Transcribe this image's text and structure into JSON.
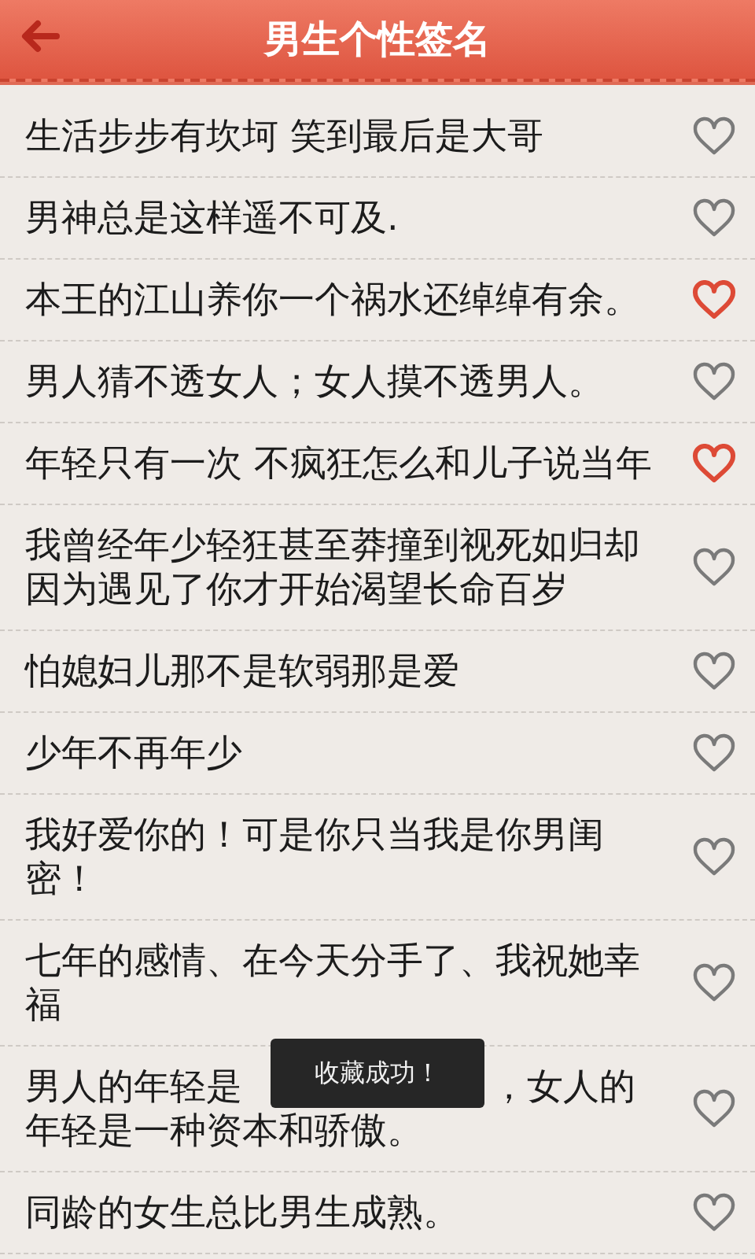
{
  "header": {
    "title": "男生个性签名"
  },
  "items": [
    {
      "text_parts": [
        "生活步步有坎坷 笑到最后是大哥"
      ],
      "favorited": false
    },
    {
      "text_parts": [
        "男神总是这样遥不可及."
      ],
      "favorited": false
    },
    {
      "text_parts": [
        "本王的江山养你一个祸水还绰绰有余。"
      ],
      "favorited": true
    },
    {
      "text_parts": [
        "男人猜不透女人；女人摸不透男人。"
      ],
      "favorited": false
    },
    {
      "text_parts": [
        "年轻只有一次 不疯狂怎么和儿子说当年"
      ],
      "favorited": true
    },
    {
      "text_parts": [
        "我曾经年少轻狂甚至莽撞到视死如归却因为遇见了你才开始渴望长命百岁"
      ],
      "favorited": false
    },
    {
      "text_parts": [
        "怕媳妇儿那不是软弱那是爱"
      ],
      "favorited": false
    },
    {
      "text_parts": [
        "少年不再年少"
      ],
      "favorited": false
    },
    {
      "text_parts": [
        "我好爱你的！可是你只当我是你男闺密！"
      ],
      "favorited": false
    },
    {
      "text_parts": [
        "七年的感情、在今天分手了、我祝她幸福"
      ],
      "favorited": false
    },
    {
      "kind": "covered",
      "lines": [
        [
          "男人的年轻是",
          "，女人的"
        ],
        [
          "年轻是一种资本和骄傲。"
        ]
      ],
      "favorited": false
    },
    {
      "text_parts": [
        "同龄的女生总比男生成熟。"
      ],
      "favorited": false
    }
  ],
  "toast": {
    "text": "收藏成功！"
  }
}
